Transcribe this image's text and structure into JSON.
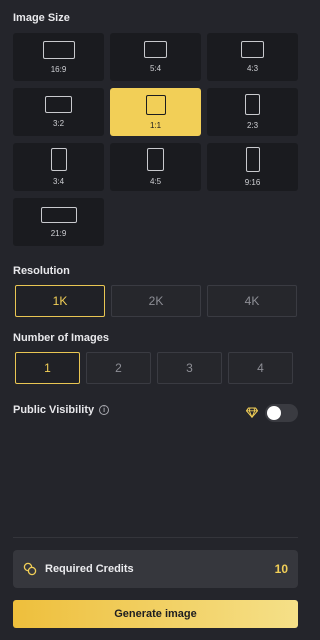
{
  "image_size": {
    "title": "Image Size",
    "options": [
      {
        "label": "16:9",
        "icon": "ratio-16-9-icon"
      },
      {
        "label": "5:4",
        "icon": "ratio-5-4-icon"
      },
      {
        "label": "4:3",
        "icon": "ratio-4-3-icon"
      },
      {
        "label": "3:2",
        "icon": "ratio-3-2-icon"
      },
      {
        "label": "1:1",
        "icon": "ratio-1-1-icon",
        "selected": true
      },
      {
        "label": "2:3",
        "icon": "ratio-2-3-icon"
      },
      {
        "label": "3:4",
        "icon": "ratio-3-4-icon"
      },
      {
        "label": "4:5",
        "icon": "ratio-4-5-icon"
      },
      {
        "label": "9:16",
        "icon": "ratio-9-16-icon"
      },
      {
        "label": "21:9",
        "icon": "ratio-21-9-icon"
      }
    ]
  },
  "resolution": {
    "title": "Resolution",
    "options": [
      "1K",
      "2K",
      "4K"
    ],
    "selected": "1K"
  },
  "num_images": {
    "title": "Number of Images",
    "options": [
      "1",
      "2",
      "3",
      "4"
    ],
    "selected": "1"
  },
  "visibility": {
    "label": "Public Visibility",
    "info_icon": "i",
    "enabled": false
  },
  "credits": {
    "label": "Required Credits",
    "value": "10"
  },
  "generate": {
    "label": "Generate image"
  },
  "colors": {
    "accent": "#f2cf57",
    "background": "#24252b",
    "tile": "#1a1b1f"
  }
}
